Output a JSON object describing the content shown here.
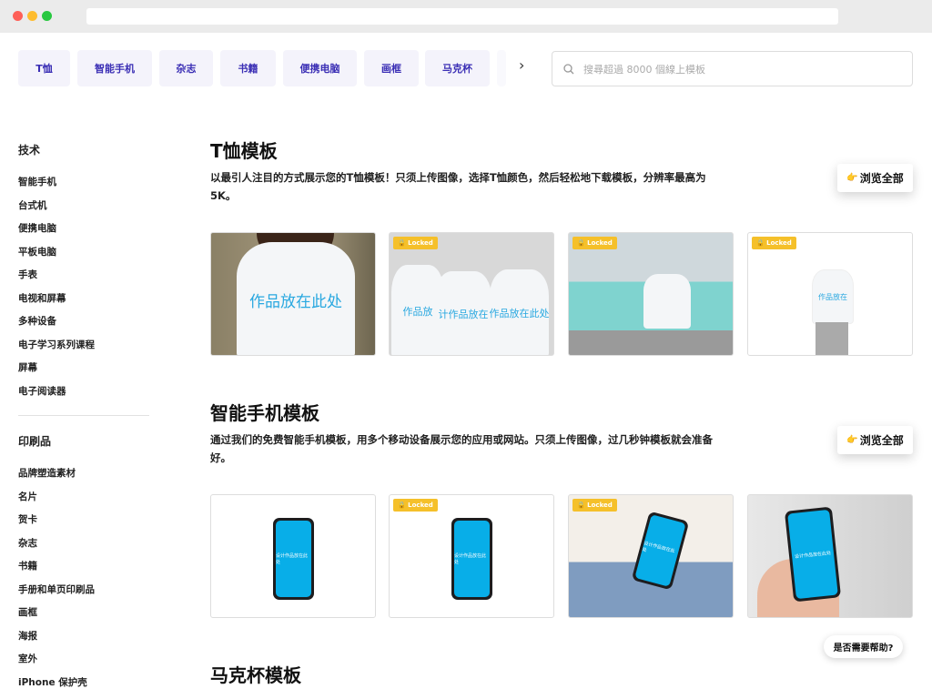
{
  "tabs": [
    "T恤",
    "智能手机",
    "杂志",
    "书籍",
    "便携电脑",
    "画框",
    "马克杯"
  ],
  "search": {
    "placeholder": "搜尋超過 8000 個線上模板"
  },
  "sidebar": {
    "groups": [
      {
        "title": "技术",
        "items": [
          "智能手机",
          "台式机",
          "便携电脑",
          "平板电脑",
          "手表",
          "电视和屏幕",
          "多种设备",
          "电子学习系列课程",
          "屏幕",
          "电子阅读器"
        ]
      },
      {
        "title": "印刷品",
        "items": [
          "品牌塑造素材",
          "名片",
          "贺卡",
          "杂志",
          "书籍",
          "手册和单页印刷品",
          "画框",
          "海报",
          "室外",
          "iPhone 保护壳"
        ]
      }
    ]
  },
  "sections": [
    {
      "title": "T恤模板",
      "desc": "以最引人注目的方式展示您的T恤模板！只须上传图像，选择T恤颜色，然后轻松地下载模板，分辨率最高为 5K。",
      "browse": "浏览全部",
      "placeholder_text": "作品放在此处"
    },
    {
      "title": "智能手机模板",
      "desc": "通过我们的免费智能手机模板，用多个移动设备展示您的应用或网站。只须上传图像，过几秒钟模板就会准备好。",
      "browse": "浏览全部",
      "placeholder_text": "设计作品放在此处"
    },
    {
      "title": "马克杯模板"
    }
  ],
  "locked_label": "Locked",
  "help": "是否需要帮助?",
  "colors": {
    "accent": "#3b2fb5",
    "tab_bg": "#f4f3fb",
    "locked": "#f5c02a",
    "screen": "#08aee8"
  }
}
